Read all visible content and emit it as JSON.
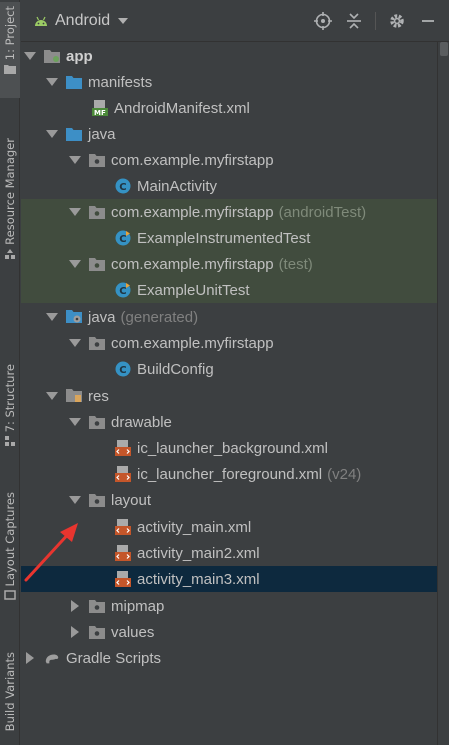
{
  "header": {
    "title": "Android"
  },
  "side_tabs": {
    "project": "1: Project",
    "resource_manager": "Resource Manager",
    "structure": "7: Structure",
    "layout_captures": "Layout Captures",
    "build_variants": "Build Variants"
  },
  "tree": {
    "app": "app",
    "manifests": "manifests",
    "android_manifest": "AndroidManifest.xml",
    "java": "java",
    "pkg1": "com.example.myfirstapp",
    "main_activity": "MainActivity",
    "pkg2": "com.example.myfirstapp",
    "pkg2_suffix": "(androidTest)",
    "instrumented_test": "ExampleInstrumentedTest",
    "pkg3": "com.example.myfirstapp",
    "pkg3_suffix": "(test)",
    "unit_test": "ExampleUnitTest",
    "java_generated": "java",
    "java_generated_suffix": "(generated)",
    "pkg4": "com.example.myfirstapp",
    "build_config": "BuildConfig",
    "res": "res",
    "drawable": "drawable",
    "ic_bg": "ic_launcher_background.xml",
    "ic_fg": "ic_launcher_foreground.xml",
    "ic_fg_suffix": "(v24)",
    "layout": "layout",
    "activity_main": "activity_main.xml",
    "activity_main2": "activity_main2.xml",
    "activity_main3": "activity_main3.xml",
    "mipmap": "mipmap",
    "values": "values",
    "gradle_scripts": "Gradle Scripts"
  },
  "colors": {
    "background": "#3c3f41",
    "selected_row": "#0d293e",
    "test_row": "#414c3e",
    "annotation_arrow": "#e8352f"
  }
}
